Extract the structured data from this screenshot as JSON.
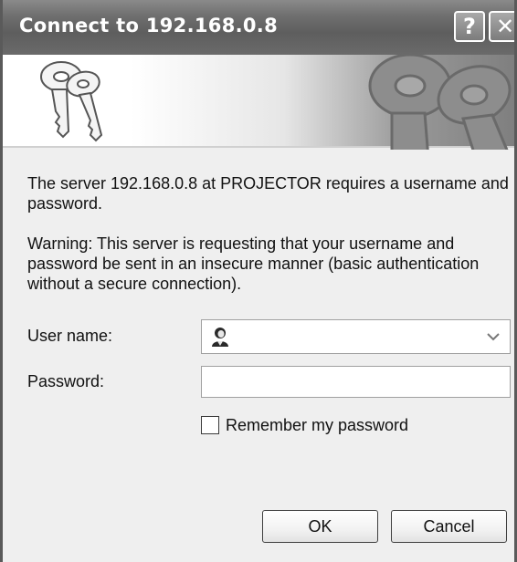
{
  "window": {
    "title": "Connect to 192.168.0.8",
    "help_label": "?",
    "close_label": "✕"
  },
  "banner": {
    "icon": "keys-icon"
  },
  "message": {
    "prompt": "The server 192.168.0.8 at PROJECTOR requires a username and password.",
    "warning": "Warning: This server is requesting that your username and password be sent in an insecure manner (basic authentication without a secure connection)."
  },
  "form": {
    "username_label": "User name:",
    "username_value": "",
    "password_label": "Password:",
    "password_value": "",
    "remember_label": "Remember my password",
    "remember_checked": false
  },
  "buttons": {
    "ok": "OK",
    "cancel": "Cancel"
  }
}
